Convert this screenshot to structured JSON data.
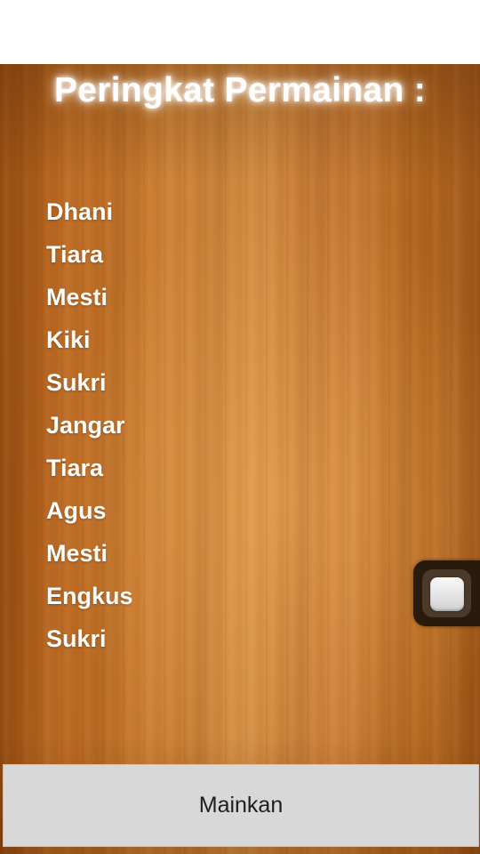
{
  "header": {
    "title": "Peringkat Permainan :"
  },
  "ranking": {
    "names": [
      "Dhani",
      "Tiara",
      "Mesti",
      "Kiki",
      "Sukri",
      "Jangar",
      "Tiara",
      "Agus",
      "Mesti",
      "Engkus",
      "Sukri"
    ]
  },
  "actions": {
    "play_label": "Mainkan"
  },
  "floating_widget": {
    "icon": "assistive-touch-icon"
  },
  "colors": {
    "title_text": "#ffffff",
    "list_text": "#ffffff",
    "wood_base": "#c87a2f",
    "button_bg": "#d8d8d9",
    "button_text": "#1e1e1e"
  }
}
